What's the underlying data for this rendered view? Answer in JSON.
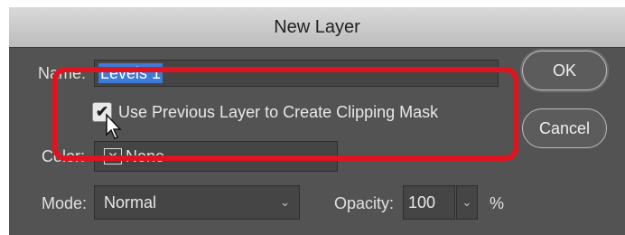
{
  "dialog": {
    "title": "New Layer",
    "name_label": "Name:",
    "name_value": "Levels 1",
    "clipping_label": "Use Previous Layer to Create Clipping Mask",
    "clipping_checked": true,
    "check_mark": "✔",
    "color_label": "Color:",
    "color_swatch": "✕",
    "color_value": "None",
    "mode_label": "Mode:",
    "mode_value": "Normal",
    "opacity_label": "Opacity:",
    "opacity_value": "100",
    "opacity_unit": "%",
    "dropdown_glyph": "⌄",
    "ok_label": "OK",
    "cancel_label": "Cancel"
  },
  "colors": {
    "dialog_bg": "#535353",
    "selection": "#3d7bd8",
    "annotation": "#e0141e"
  },
  "icons": {
    "cursor": "arrow-cursor-icon",
    "mode_dropdown": "chevron-down-icon",
    "opacity_dropdown": "chevron-down-icon"
  }
}
